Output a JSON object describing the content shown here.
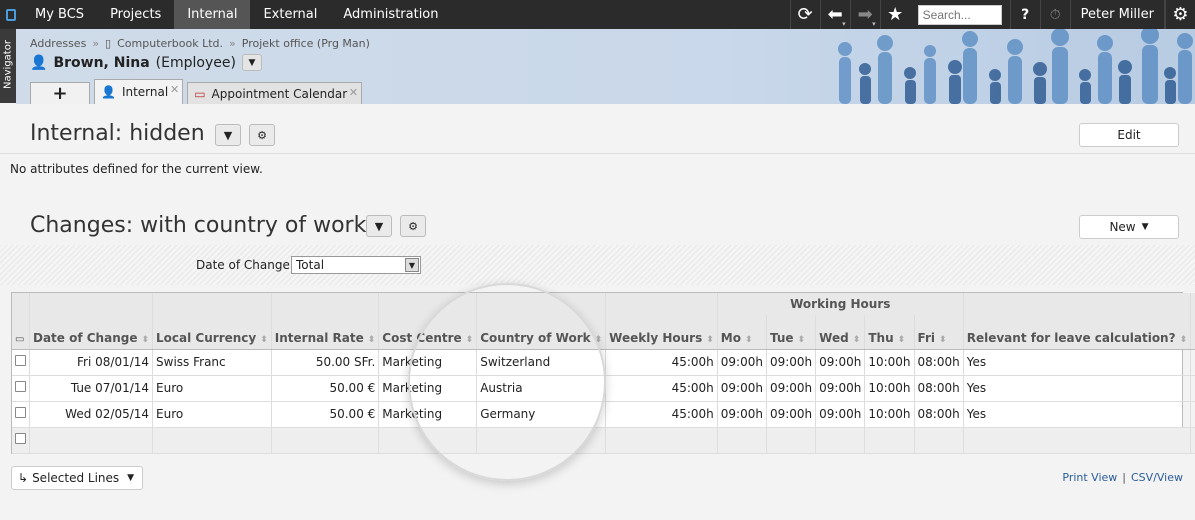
{
  "topnav": {
    "tabs": [
      {
        "label": "My BCS",
        "active": false
      },
      {
        "label": "Projects",
        "active": false
      },
      {
        "label": "Internal",
        "active": true
      },
      {
        "label": "External",
        "active": false
      },
      {
        "label": "Administration",
        "active": false
      }
    ],
    "search_placeholder": "Search...",
    "help_label": "?",
    "user_name": "Peter Miller",
    "icons": [
      "refresh-icon",
      "back-icon",
      "forward-icon",
      "star-icon",
      "stopwatch-icon",
      "gear-icon"
    ]
  },
  "navigator": {
    "label": "Navigator"
  },
  "breadcrumb": [
    "Addresses",
    "Computerbook Ltd.",
    "Projekt office (Prg Man)"
  ],
  "person": {
    "name": "Brown, Nina",
    "role": "(Employee)"
  },
  "tabs": [
    {
      "label": "+"
    },
    {
      "label": "Internal",
      "active": true
    },
    {
      "label": "Appointment Calendar",
      "active": false
    }
  ],
  "section1": {
    "title": "Internal: hidden",
    "edit_label": "Edit",
    "message": "No attributes defined for the current view."
  },
  "section2": {
    "title": "Changes: with country of work",
    "new_label": "New",
    "filter_label": "Date of Change",
    "filter_value": "Total"
  },
  "table": {
    "group_header": "Working Hours",
    "columns": [
      "Date of Change",
      "Local Currency",
      "Internal Rate",
      "Cost Centre",
      "Country of Work",
      "Weekly Hours",
      "Mo",
      "Tue",
      "Wed",
      "Thu",
      "Fri",
      "Relevant for leave calculation?"
    ],
    "rows": [
      {
        "date": "Fri 08/01/14",
        "currency": "Swiss Franc",
        "rate": "50.00 SFr.",
        "cost_centre": "Marketing",
        "country": "Switzerland",
        "weekly": "45:00h",
        "mo": "09:00h",
        "tue": "09:00h",
        "wed": "09:00h",
        "thu": "10:00h",
        "fri": "08:00h",
        "relevant": "Yes"
      },
      {
        "date": "Tue 07/01/14",
        "currency": "Euro",
        "rate": "50.00 €",
        "cost_centre": "Marketing",
        "country": "Austria",
        "weekly": "45:00h",
        "mo": "09:00h",
        "tue": "09:00h",
        "wed": "09:00h",
        "thu": "10:00h",
        "fri": "08:00h",
        "relevant": "Yes"
      },
      {
        "date": "Wed 02/05/14",
        "currency": "Euro",
        "rate": "50.00 €",
        "cost_centre": "Marketing",
        "country": "Germany",
        "weekly": "45:00h",
        "mo": "09:00h",
        "tue": "09:00h",
        "wed": "09:00h",
        "thu": "10:00h",
        "fri": "08:00h",
        "relevant": "Yes"
      }
    ]
  },
  "footer": {
    "selected_lines_label": "Selected Lines",
    "print_view": "Print View",
    "separator": "|",
    "csv_view": "CSV/View"
  }
}
